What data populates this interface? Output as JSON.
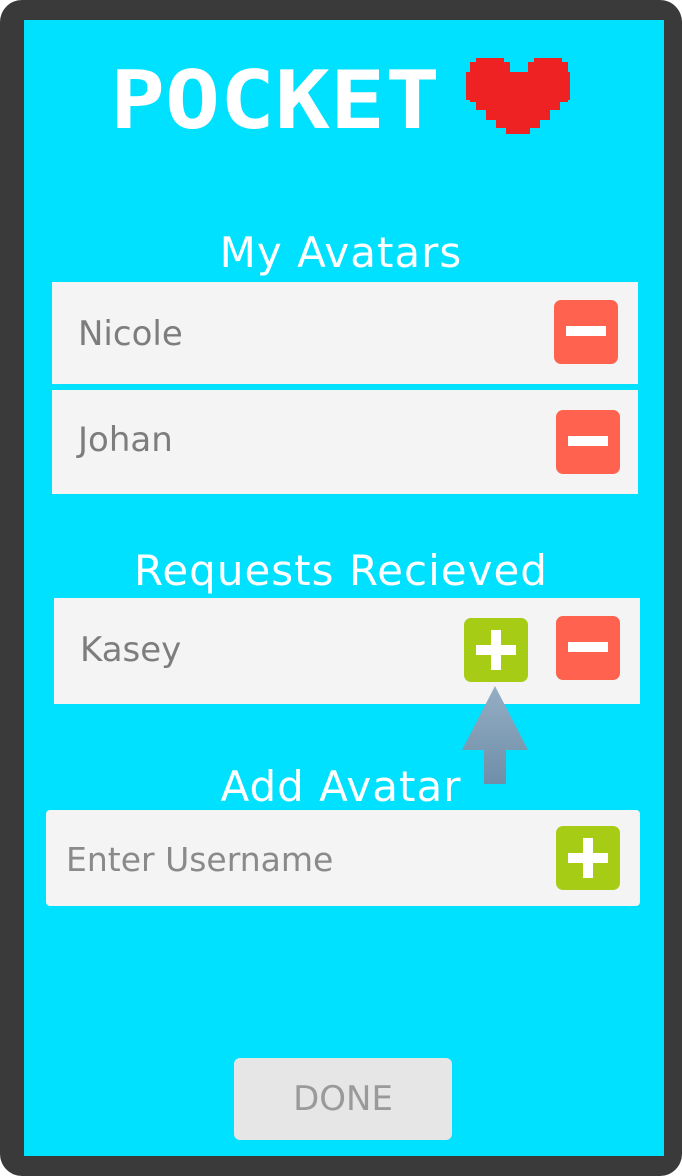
{
  "app": {
    "title": "POCKET",
    "logo_icon": "pixel-heart-icon"
  },
  "colors": {
    "background": "#00e0ff",
    "remove": "#ff6350",
    "add": "#a7cc16",
    "heart": "#ee2222"
  },
  "my_avatars": {
    "title": "My Avatars",
    "items": [
      {
        "name": "Nicole"
      },
      {
        "name": "Johan"
      }
    ]
  },
  "requests": {
    "title": "Requests Recieved",
    "items": [
      {
        "name": "Kasey"
      }
    ]
  },
  "add_avatar": {
    "title": "Add Avatar",
    "placeholder": "Enter Username"
  },
  "done_label": "DONE"
}
